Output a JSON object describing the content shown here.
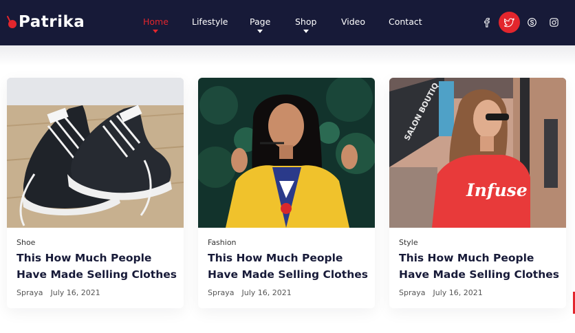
{
  "brand": {
    "name": "Patrika",
    "accent": "#e3262d",
    "nav_bg": "#171a38"
  },
  "nav": {
    "items": [
      {
        "label": "Home",
        "active": true,
        "dropdown": true
      },
      {
        "label": "Lifestyle",
        "active": false,
        "dropdown": false
      },
      {
        "label": "Page",
        "active": false,
        "dropdown": true
      },
      {
        "label": "Shop",
        "active": false,
        "dropdown": true
      },
      {
        "label": "Video",
        "active": false,
        "dropdown": false
      },
      {
        "label": "Contact",
        "active": false,
        "dropdown": false
      }
    ]
  },
  "social": [
    {
      "icon": "facebook-icon",
      "active": false
    },
    {
      "icon": "twitter-icon",
      "active": true
    },
    {
      "icon": "skype-icon",
      "active": false
    },
    {
      "icon": "instagram-icon",
      "active": false
    }
  ],
  "posts": [
    {
      "image": "sneakers-photo",
      "category": "Shoe",
      "title": "This How Much People Have Made Selling Clothes",
      "author": "Spraya",
      "date": "July 16, 2021"
    },
    {
      "image": "woman-yellow-jacket-photo",
      "category": "Fashion",
      "title": "This How Much People Have Made Selling Clothes",
      "author": "Spraya",
      "date": "July 16, 2021"
    },
    {
      "image": "woman-red-shirt-photo",
      "category": "Style",
      "title": "This How Much People Have Made Selling Clothes",
      "author": "Spraya",
      "date": "July 16, 2021"
    }
  ],
  "photo_text": {
    "shirt_print": "Infuse",
    "storefront_sign": "SALON BOUTIQ"
  }
}
